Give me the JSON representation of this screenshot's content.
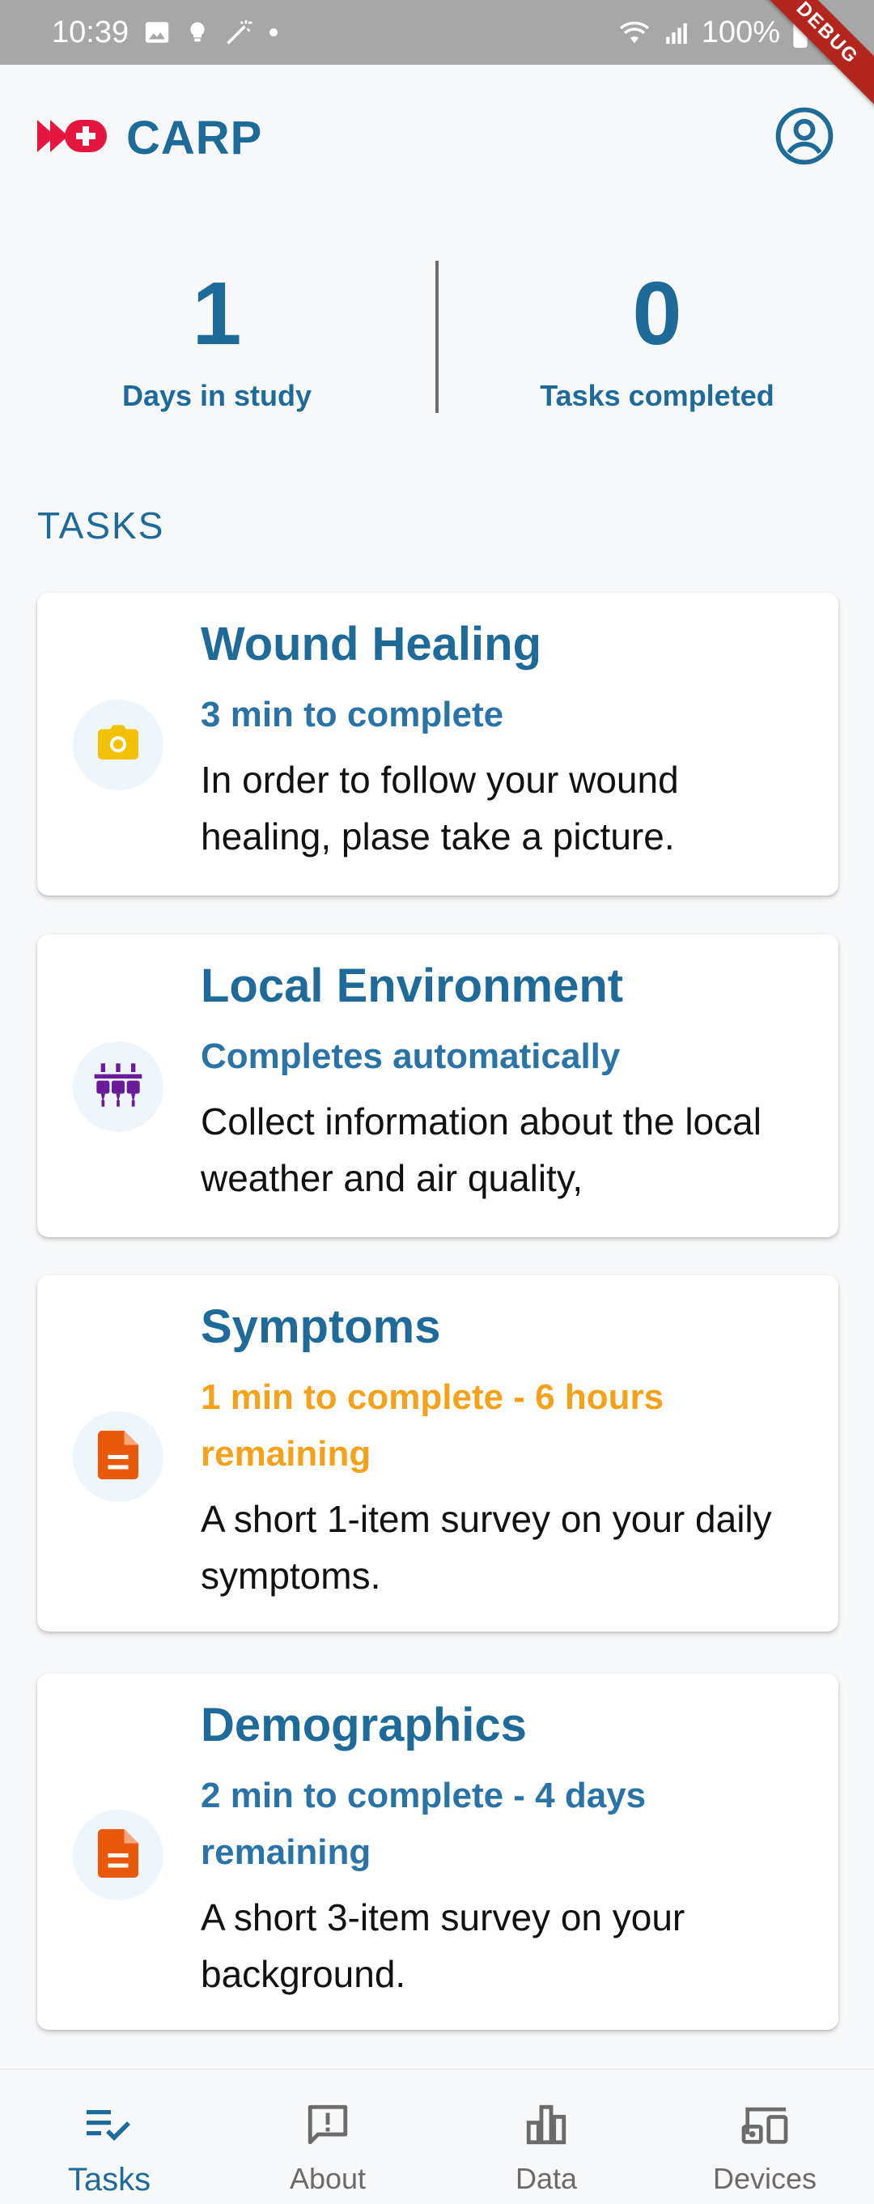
{
  "status_bar": {
    "time": "10:39",
    "battery": "100%",
    "debug_label": "DEBUG"
  },
  "app_bar": {
    "brand": "CARP"
  },
  "stats": {
    "days": {
      "value": "1",
      "label": "Days in study"
    },
    "tasks": {
      "value": "0",
      "label": "Tasks completed"
    }
  },
  "section": {
    "title": "TASKS"
  },
  "tasks": [
    {
      "title": "Wound Healing",
      "meta": "3 min to complete",
      "desc": "In order to follow your wound healing, plase take a picture.",
      "icon": "camera-icon",
      "icon_color": "#f2c200"
    },
    {
      "title": "Local Environment",
      "meta": "Completes automatically",
      "desc": "Collect information about the local weather and air quality,",
      "icon": "sensors-icon",
      "icon_color": "#6a1b9a"
    },
    {
      "title": "Symptoms",
      "meta": "1 min to complete - 6 hours remaining",
      "desc": "A short 1-item survey on your daily symptoms.",
      "icon": "document-icon",
      "icon_color": "#e8590c"
    },
    {
      "title": "Demographics",
      "meta": "2 min to complete - 4 days remaining",
      "desc": "A short 3-item survey on your background.",
      "icon": "document-icon",
      "icon_color": "#e8590c"
    }
  ],
  "bottom_nav": {
    "items": [
      {
        "label": "Tasks",
        "icon": "task-list-icon",
        "active": true
      },
      {
        "label": "About",
        "icon": "feedback-icon",
        "active": false
      },
      {
        "label": "Data",
        "icon": "bar-chart-icon",
        "active": false
      },
      {
        "label": "Devices",
        "icon": "devices-icon",
        "active": false
      }
    ]
  },
  "colors": {
    "primary": "#1e6a98",
    "warning": "#f5a21a",
    "brand_red": "#e5173f"
  }
}
